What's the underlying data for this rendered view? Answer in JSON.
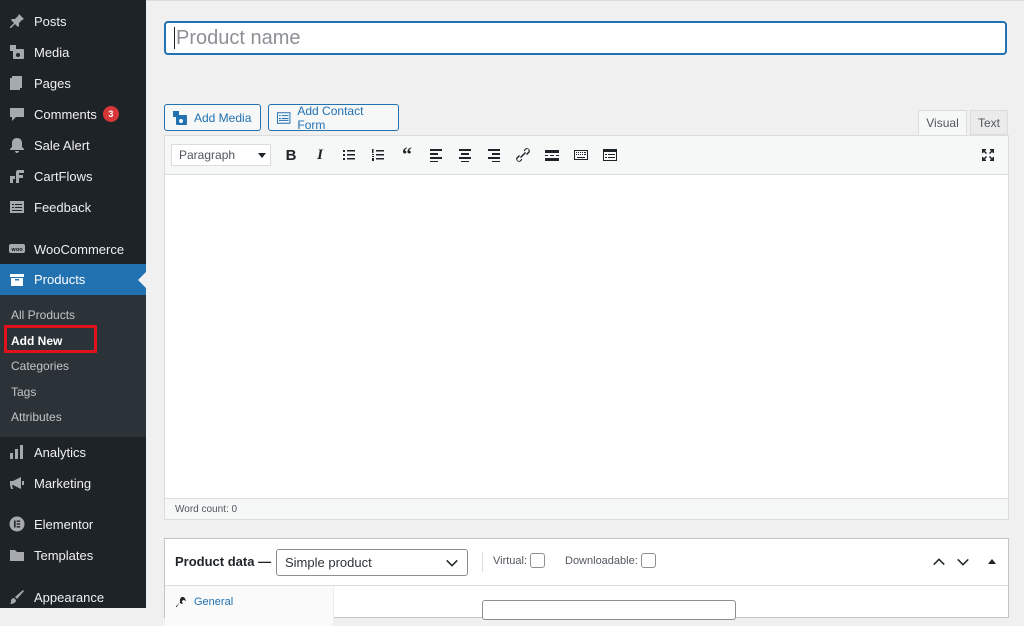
{
  "sidebar": {
    "items": [
      {
        "label": "Posts",
        "icon": "pin-icon"
      },
      {
        "label": "Media",
        "icon": "media-icon"
      },
      {
        "label": "Pages",
        "icon": "pages-icon"
      },
      {
        "label": "Comments",
        "icon": "comments-icon",
        "badge": "3"
      },
      {
        "label": "Sale Alert",
        "icon": "bell-icon"
      },
      {
        "label": "CartFlows",
        "icon": "cartflows-icon"
      },
      {
        "label": "Feedback",
        "icon": "feedback-icon"
      },
      {
        "label": "WooCommerce",
        "icon": "woocommerce-icon"
      },
      {
        "label": "Products",
        "icon": "products-icon",
        "active": true
      },
      {
        "label": "Analytics",
        "icon": "analytics-icon"
      },
      {
        "label": "Marketing",
        "icon": "megaphone-icon"
      },
      {
        "label": "Elementor",
        "icon": "elementor-icon"
      },
      {
        "label": "Templates",
        "icon": "folder-icon"
      },
      {
        "label": "Appearance",
        "icon": "brush-icon"
      }
    ],
    "submenu": [
      "All Products",
      "Add New",
      "Categories",
      "Tags",
      "Attributes"
    ],
    "current_submenu": "Add New"
  },
  "editor": {
    "title_placeholder": "Product name",
    "add_media_label": "Add Media",
    "add_contact_form_label": "Add Contact Form",
    "tab_visual": "Visual",
    "tab_text": "Text",
    "format_select": "Paragraph",
    "word_count": "Word count: 0"
  },
  "product_data": {
    "title": "Product data —",
    "type_select": "Simple product",
    "virtual_label": "Virtual:",
    "downloadable_label": "Downloadable:",
    "tab_general": "General"
  },
  "colors": {
    "sidebar_bg": "#1d2327",
    "accent": "#2271b1",
    "badge": "#d63638",
    "highlight": "#e0121b"
  }
}
